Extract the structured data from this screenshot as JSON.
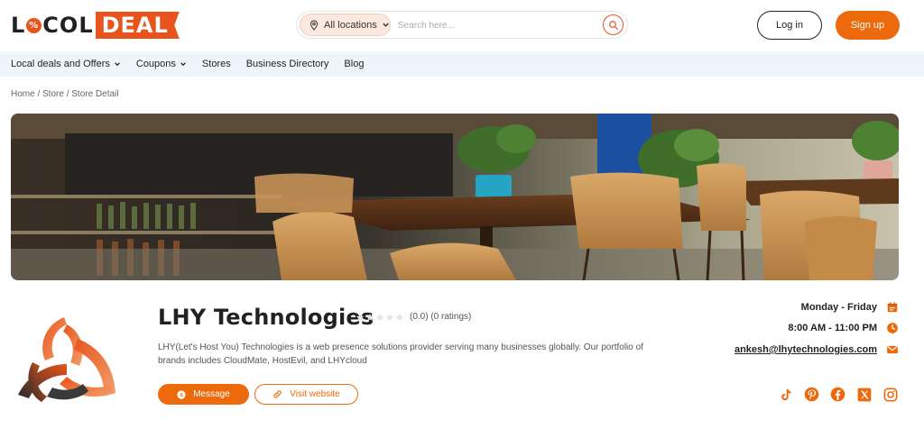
{
  "header": {
    "logo_part1": "LOCOL",
    "logo_part2": "DEAL",
    "location_label": "All locations",
    "search_placeholder": "Search here...",
    "login_label": "Log in",
    "signup_label": "Sign up"
  },
  "nav": {
    "items": [
      {
        "label": "Local deals and Offers",
        "has_dropdown": true
      },
      {
        "label": "Coupons",
        "has_dropdown": true
      },
      {
        "label": "Stores",
        "has_dropdown": false
      },
      {
        "label": "Business Directory",
        "has_dropdown": false
      },
      {
        "label": "Blog",
        "has_dropdown": false
      }
    ]
  },
  "breadcrumb": "Home / Store / Store Detail",
  "store": {
    "name": "LHY Technologies",
    "rating": 0.0,
    "rating_text": "(0.0) (0 ratings)",
    "description": "LHY(Let's Host You) Technologies is a web presence solutions provider serving many businesses globally. Our portfolio of brands includes CloudMate, HostEvil, and LHYcloud",
    "message_label": "Message",
    "website_label": "Visit website",
    "days": "Monday - Friday",
    "hours": "8:00 AM - 11:00 PM",
    "email": "ankesh@lhytechnologies.com",
    "socials": [
      "tiktok-icon",
      "pinterest-icon",
      "facebook-icon",
      "x-icon",
      "instagram-icon"
    ]
  },
  "colors": {
    "accent": "#ec6a0c",
    "brand_red": "#e8541c",
    "nav_bg": "#eef5fb"
  }
}
